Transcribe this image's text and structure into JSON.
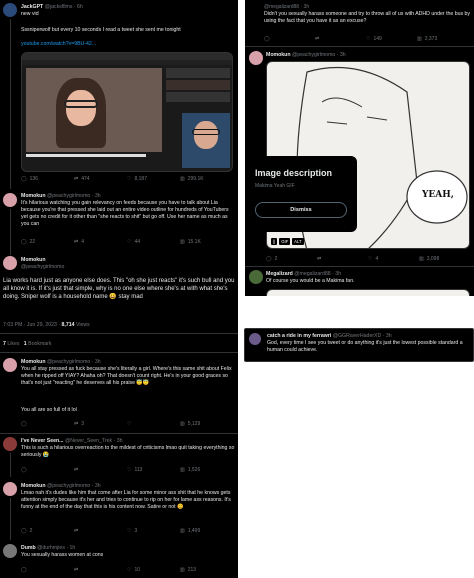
{
  "left": {
    "t1": {
      "name": "JackGPT",
      "handle": "@jacksfilms",
      "time": "· 6h",
      "text": "new vid",
      "body": "Sssniperwolf but every 10 seconds I read a tweet she sent me tonight",
      "link": "youtube.com/watch?v=9BU-42...",
      "stats": [
        "136",
        "474",
        "8,187",
        "299.1K"
      ]
    },
    "t2": {
      "name": "Momokun",
      "handle": "@peachygirlmomo",
      "time": "· 3h",
      "text": "It's hilarious watching you gain relevancy on feeds because you have to talk about Lia because you're that pressed she laid out an entire video outline for hundreds of YouTubers yet gets no credit for it other than \"she reacts to shit\" but go off. Use her name as much as you can",
      "stats": [
        "22",
        "4",
        "44",
        "15.1K"
      ]
    },
    "main": {
      "name": "Momokun",
      "handle": "@peachygirlmomo",
      "text": "Lia works hard just as anyone else does. This \"oh she just reacts\" it's such bull and you all know it is. If it's just that simple, why is no one else where she's at with what she's doing. Sniper wolf is a household name 😀 stay mad",
      "meta": "7:03 PM · Jun 29, 2023 · ",
      "views": "8,714",
      "views_label": "Views",
      "likes": "7",
      "likes_label": "Likes",
      "bookmarks": "1",
      "bookmarks_label": "Bookmark"
    },
    "r1": {
      "name": "Momokun",
      "handle": "@peachygirlmomo",
      "time": "· 3h",
      "text": "You all stay pressed as fuck because she's literally a girl. Where's this same shit about Felix when he ripped off YIAY? Ahaha oh? That doesn't count right. He's in your good graces so that's not just \"reacting\" he deserves all his praise 😇😇",
      "text2": "You all are so full of it lol",
      "stats": [
        "",
        "3",
        "",
        "5,129"
      ]
    },
    "r2": {
      "name": "I've Never Seen...",
      "handle": "@Never_Seen_Trek",
      "time": "· 3h",
      "text": "This is such a hilarious overreaction to the mildest of criticisms lmao quit taking everything so seriously 😭",
      "stats": [
        "",
        "",
        "113",
        "1,526"
      ]
    },
    "r3": {
      "name": "Momokun",
      "handle": "@peachygirlmomo",
      "time": "· 3h",
      "text": "Lmao nah it's dudes like him that come after Lia for some minor ass shit that he knows gets attention simply because it's her and tries to continue to rip on her for lame ass reasons. It's funny at the end of the day that this is his content now. Satire or not 😊",
      "stats": [
        "2",
        "",
        "3",
        "1,499"
      ]
    },
    "r4": {
      "name": "Dumb",
      "handle": "@durhmjies",
      "time": "· 1h",
      "text": "You sexually harass women at cons",
      "stats": [
        "",
        "",
        "10",
        "213"
      ]
    }
  },
  "right": {
    "top": {
      "text": "Didn't you sexually harass someone and try to throw all of us with ADHD under the bus by using the fact that you have it as an excuse?",
      "handle": "@megalizard88 · 3h",
      "stats": [
        "",
        "",
        "149",
        "2,373"
      ]
    },
    "momo": {
      "name": "Momokun",
      "handle": "@peachygirlmomo",
      "time": "· 3h",
      "modal_title": "Image description",
      "modal_sub": "Makima Yeah GIF",
      "dismiss": "Dismiss",
      "bubble": "YEAH,",
      "badges": [
        "||",
        "GIF",
        "ALT"
      ],
      "stats": [
        "2",
        "",
        "4",
        "3,098"
      ]
    },
    "mega": {
      "name": "Megalizard",
      "handle": "@megalizard88",
      "time": "· 3h",
      "text": "Of course you would be a Makima fan."
    }
  },
  "card": {
    "name": "catch a ride in my ferrawri",
    "handle": "@GGRaverHaderXD",
    "time": "· 3h",
    "text": "God, every time I see you tweet or do anything it's just the lowest possible standard a human could achieve."
  },
  "colors": {
    "bg": "#000000",
    "text": "#e7e9ea",
    "muted": "#71767b",
    "link": "#1d9bf0",
    "border": "#2f3336"
  }
}
